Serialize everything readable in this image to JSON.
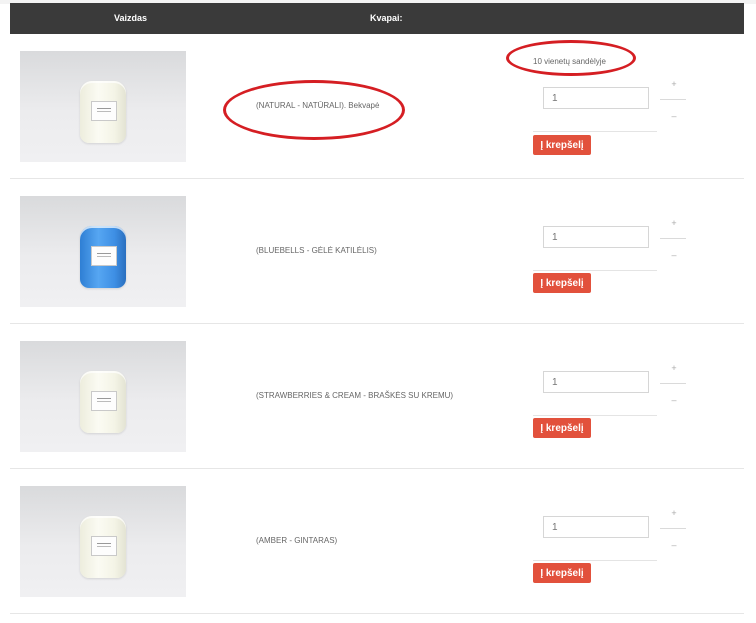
{
  "header": {
    "col_image": "Vaizdas",
    "col_scent": "Kvapai:"
  },
  "products": [
    {
      "scent": "(NATURAL - NATŪRALI). Bekvapė",
      "stock": "10 vienetų sandėlyje",
      "qty_placeholder": "1",
      "cart_label": "Į krepšelį",
      "plus": "+",
      "minus": "–",
      "jar_color": "#f6f6ea"
    },
    {
      "scent": "(BLUEBELLS - GĖLĖ KATILĖLIS)",
      "qty_placeholder": "1",
      "cart_label": "Į krepšelį",
      "plus": "+",
      "minus": "–",
      "jar_color": "#3e8fe4"
    },
    {
      "scent": "(STRAWBERRIES & CREAM - BRAŠKĖS SU KREMU)",
      "qty_placeholder": "1",
      "cart_label": "Į krepšelį",
      "plus": "+",
      "minus": "–",
      "jar_color": "#f6f6ea"
    },
    {
      "scent": "(AMBER - GINTARAS)",
      "qty_placeholder": "1",
      "cart_label": "Į krepšelį",
      "plus": "+",
      "minus": "–",
      "jar_color": "#f6f6ea"
    }
  ],
  "annotation_color": "#d51e23",
  "button_color": "#e2513c"
}
